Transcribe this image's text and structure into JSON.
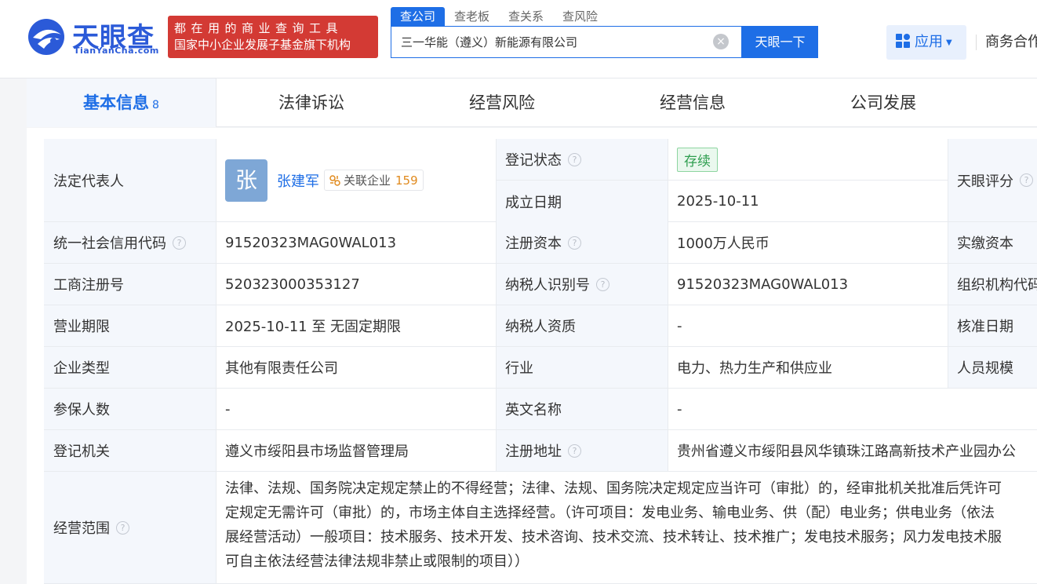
{
  "header": {
    "logo_cn": "天眼查",
    "logo_en": "TianYanCha.com",
    "slogan_line1": "都在用的商业查询工具",
    "slogan_line2": "国家中小企业发展子基金旗下机构",
    "search_tabs": [
      "查公司",
      "查老板",
      "查关系",
      "查风险"
    ],
    "search_value": "三一华能（遵义）新能源有限公司",
    "search_button": "天眼一下",
    "app_button": "应用",
    "biz_link": "商务合作"
  },
  "tabs": {
    "basic": "基本信息",
    "basic_count": "8",
    "legal": "法律诉讼",
    "risk": "经营风险",
    "info": "经营信息",
    "develop": "公司发展"
  },
  "info": {
    "legal_rep_label": "法定代表人",
    "legal_rep_avatar": "张",
    "legal_rep_name": "张建军",
    "related_label": "关联企业",
    "related_count": "159",
    "reg_status_label": "登记状态",
    "reg_status": "存续",
    "found_date_label": "成立日期",
    "found_date": "2025-10-11",
    "rating_label": "天眼评分",
    "credit_code_label": "统一社会信用代码",
    "credit_code": "91520323MAG0WAL013",
    "reg_capital_label": "注册资本",
    "reg_capital": "1000万人民币",
    "paid_capital_label": "实缴资本",
    "biz_reg_no_label": "工商注册号",
    "biz_reg_no": "520323000353127",
    "taxpayer_id_label": "纳税人识别号",
    "taxpayer_id": "91520323MAG0WAL013",
    "org_code_label": "组织机构代码",
    "term_label": "营业期限",
    "term": "2025-10-11 至 无固定期限",
    "taxpayer_qual_label": "纳税人资质",
    "taxpayer_qual": "-",
    "approve_date_label": "核准日期",
    "company_type_label": "企业类型",
    "company_type": "其他有限责任公司",
    "industry_label": "行业",
    "industry": "电力、热力生产和供应业",
    "staff_size_label": "人员规模",
    "insured_label": "参保人数",
    "insured": "-",
    "english_name_label": "英文名称",
    "english_name": "-",
    "reg_authority_label": "登记机关",
    "reg_authority": "遵义市绥阳县市场监督管理局",
    "reg_address_label": "注册地址",
    "reg_address": "贵州省遵义市绥阳县风华镇珠江路高新技术产业园办公",
    "scope_label": "经营范围",
    "scope_lines": [
      "法律、法规、国务院决定规定禁止的不得经营；法律、法规、国务院决定规定应当许可（审批）的，经审批机关批准后凭许可",
      "定规定无需许可（审批）的，市场主体自主选择经营。（许可项目：发电业务、输电业务、供（配）电业务；供电业务（依法",
      "展经营活动）一般项目：技术服务、技术开发、技术咨询、技术交流、技术转让、技术推广；发电技术服务；风力发电技术服",
      "可自主依法经营法律法规非禁止或限制的项目））"
    ]
  }
}
